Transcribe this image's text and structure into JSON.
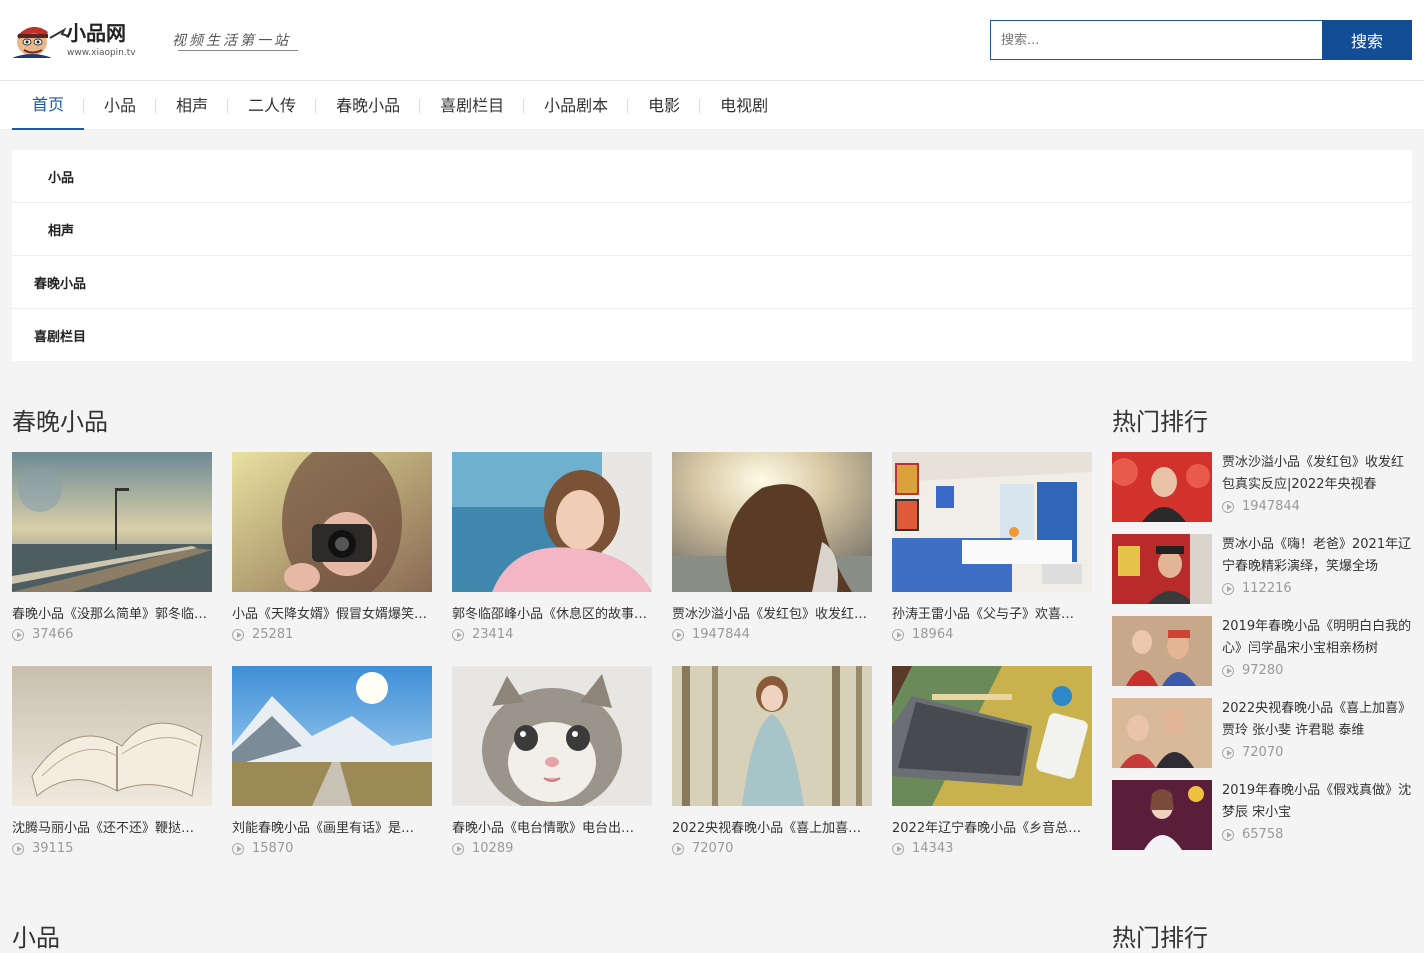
{
  "header": {
    "logo_text": "小品网",
    "logo_url": "www.xiaopin.tv",
    "slogan": "视频生活第一站",
    "search_placeholder": "搜索...",
    "search_button": "搜索"
  },
  "nav": {
    "items": [
      "首页",
      "小品",
      "相声",
      "二人传",
      "春晚小品",
      "喜剧栏目",
      "小品剧本",
      "电影",
      "电视剧"
    ],
    "active_index": 0
  },
  "subnav": {
    "items": [
      "小品",
      "相声",
      "春晚小品",
      "喜剧栏目"
    ]
  },
  "section": {
    "title": "春晚小品",
    "cards": [
      {
        "title": "春晚小品《没那么简单》郭冬临…",
        "views": "37466",
        "icon": "play-icon"
      },
      {
        "title": "小品《天降女婿》假冒女婿爆笑…",
        "views": "25281",
        "icon": "play-icon"
      },
      {
        "title": "郭冬临邵峰小品《休息区的故事…",
        "views": "23414",
        "icon": "play-icon"
      },
      {
        "title": "贾冰沙溢小品《发红包》收发红…",
        "views": "1947844",
        "icon": "play-icon"
      },
      {
        "title": "孙涛王雷小品《父与子》欢喜…",
        "views": "18964",
        "icon": "play-icon"
      },
      {
        "title": "沈腾马丽小品《还不还》鞭挞…",
        "views": "39115",
        "icon": "play-icon"
      },
      {
        "title": "刘能春晚小品《画里有话》是…",
        "views": "15870",
        "icon": "play-icon"
      },
      {
        "title": "春晚小品《电台情歌》电台出…",
        "views": "10289",
        "icon": "play-icon"
      },
      {
        "title": "2022央视春晚小品《喜上加喜…",
        "views": "72070",
        "icon": "play-icon"
      },
      {
        "title": "2022年辽宁春晚小品《乡音总…",
        "views": "14343",
        "icon": "play-icon"
      }
    ]
  },
  "next_section": {
    "title": "小品",
    "rank_title": "热门排行"
  },
  "rank": {
    "title": "热门排行",
    "items": [
      {
        "title": "贾冰沙溢小品《发红包》收发红包真实反应|2022年央视春",
        "views": "1947844"
      },
      {
        "title": "贾冰小品《嗨！老爸》2021年辽宁春晚精彩演绎，笑爆全场",
        "views": "112216"
      },
      {
        "title": "2019年春晚小品《明明白白我的心》闫学晶宋小宝相亲杨树",
        "views": "97280"
      },
      {
        "title": "2022央视春晚小品《喜上加喜》贾玲 张小斐 许君聪 泰维",
        "views": "72070"
      },
      {
        "title": "2019年春晚小品《假戏真做》沈梦辰 宋小宝",
        "views": "65758"
      }
    ]
  },
  "colors": {
    "accent": "#1a5aa8",
    "search_button": "#134d96",
    "background": "#f4f4f4"
  }
}
